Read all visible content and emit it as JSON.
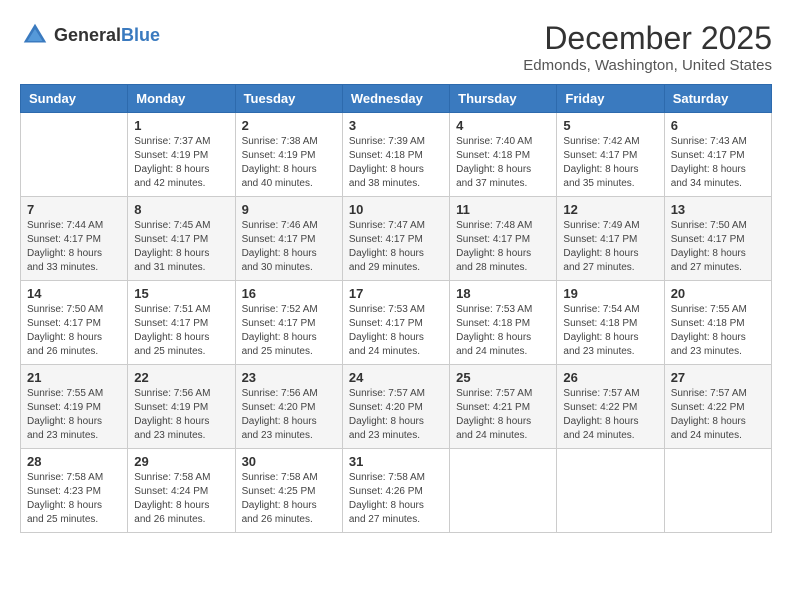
{
  "header": {
    "logo_general": "General",
    "logo_blue": "Blue",
    "month": "December 2025",
    "location": "Edmonds, Washington, United States"
  },
  "weekdays": [
    "Sunday",
    "Monday",
    "Tuesday",
    "Wednesday",
    "Thursday",
    "Friday",
    "Saturday"
  ],
  "weeks": [
    [
      {
        "day": "",
        "info": ""
      },
      {
        "day": "1",
        "info": "Sunrise: 7:37 AM\nSunset: 4:19 PM\nDaylight: 8 hours\nand 42 minutes."
      },
      {
        "day": "2",
        "info": "Sunrise: 7:38 AM\nSunset: 4:19 PM\nDaylight: 8 hours\nand 40 minutes."
      },
      {
        "day": "3",
        "info": "Sunrise: 7:39 AM\nSunset: 4:18 PM\nDaylight: 8 hours\nand 38 minutes."
      },
      {
        "day": "4",
        "info": "Sunrise: 7:40 AM\nSunset: 4:18 PM\nDaylight: 8 hours\nand 37 minutes."
      },
      {
        "day": "5",
        "info": "Sunrise: 7:42 AM\nSunset: 4:17 PM\nDaylight: 8 hours\nand 35 minutes."
      },
      {
        "day": "6",
        "info": "Sunrise: 7:43 AM\nSunset: 4:17 PM\nDaylight: 8 hours\nand 34 minutes."
      }
    ],
    [
      {
        "day": "7",
        "info": "Sunrise: 7:44 AM\nSunset: 4:17 PM\nDaylight: 8 hours\nand 33 minutes."
      },
      {
        "day": "8",
        "info": "Sunrise: 7:45 AM\nSunset: 4:17 PM\nDaylight: 8 hours\nand 31 minutes."
      },
      {
        "day": "9",
        "info": "Sunrise: 7:46 AM\nSunset: 4:17 PM\nDaylight: 8 hours\nand 30 minutes."
      },
      {
        "day": "10",
        "info": "Sunrise: 7:47 AM\nSunset: 4:17 PM\nDaylight: 8 hours\nand 29 minutes."
      },
      {
        "day": "11",
        "info": "Sunrise: 7:48 AM\nSunset: 4:17 PM\nDaylight: 8 hours\nand 28 minutes."
      },
      {
        "day": "12",
        "info": "Sunrise: 7:49 AM\nSunset: 4:17 PM\nDaylight: 8 hours\nand 27 minutes."
      },
      {
        "day": "13",
        "info": "Sunrise: 7:50 AM\nSunset: 4:17 PM\nDaylight: 8 hours\nand 27 minutes."
      }
    ],
    [
      {
        "day": "14",
        "info": "Sunrise: 7:50 AM\nSunset: 4:17 PM\nDaylight: 8 hours\nand 26 minutes."
      },
      {
        "day": "15",
        "info": "Sunrise: 7:51 AM\nSunset: 4:17 PM\nDaylight: 8 hours\nand 25 minutes."
      },
      {
        "day": "16",
        "info": "Sunrise: 7:52 AM\nSunset: 4:17 PM\nDaylight: 8 hours\nand 25 minutes."
      },
      {
        "day": "17",
        "info": "Sunrise: 7:53 AM\nSunset: 4:17 PM\nDaylight: 8 hours\nand 24 minutes."
      },
      {
        "day": "18",
        "info": "Sunrise: 7:53 AM\nSunset: 4:18 PM\nDaylight: 8 hours\nand 24 minutes."
      },
      {
        "day": "19",
        "info": "Sunrise: 7:54 AM\nSunset: 4:18 PM\nDaylight: 8 hours\nand 23 minutes."
      },
      {
        "day": "20",
        "info": "Sunrise: 7:55 AM\nSunset: 4:18 PM\nDaylight: 8 hours\nand 23 minutes."
      }
    ],
    [
      {
        "day": "21",
        "info": "Sunrise: 7:55 AM\nSunset: 4:19 PM\nDaylight: 8 hours\nand 23 minutes."
      },
      {
        "day": "22",
        "info": "Sunrise: 7:56 AM\nSunset: 4:19 PM\nDaylight: 8 hours\nand 23 minutes."
      },
      {
        "day": "23",
        "info": "Sunrise: 7:56 AM\nSunset: 4:20 PM\nDaylight: 8 hours\nand 23 minutes."
      },
      {
        "day": "24",
        "info": "Sunrise: 7:57 AM\nSunset: 4:20 PM\nDaylight: 8 hours\nand 23 minutes."
      },
      {
        "day": "25",
        "info": "Sunrise: 7:57 AM\nSunset: 4:21 PM\nDaylight: 8 hours\nand 24 minutes."
      },
      {
        "day": "26",
        "info": "Sunrise: 7:57 AM\nSunset: 4:22 PM\nDaylight: 8 hours\nand 24 minutes."
      },
      {
        "day": "27",
        "info": "Sunrise: 7:57 AM\nSunset: 4:22 PM\nDaylight: 8 hours\nand 24 minutes."
      }
    ],
    [
      {
        "day": "28",
        "info": "Sunrise: 7:58 AM\nSunset: 4:23 PM\nDaylight: 8 hours\nand 25 minutes."
      },
      {
        "day": "29",
        "info": "Sunrise: 7:58 AM\nSunset: 4:24 PM\nDaylight: 8 hours\nand 26 minutes."
      },
      {
        "day": "30",
        "info": "Sunrise: 7:58 AM\nSunset: 4:25 PM\nDaylight: 8 hours\nand 26 minutes."
      },
      {
        "day": "31",
        "info": "Sunrise: 7:58 AM\nSunset: 4:26 PM\nDaylight: 8 hours\nand 27 minutes."
      },
      {
        "day": "",
        "info": ""
      },
      {
        "day": "",
        "info": ""
      },
      {
        "day": "",
        "info": ""
      }
    ]
  ]
}
